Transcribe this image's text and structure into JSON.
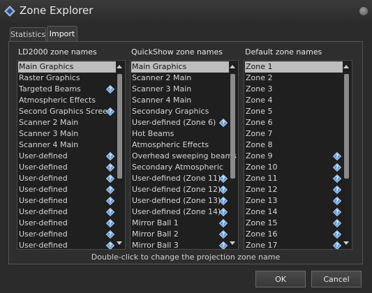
{
  "window": {
    "title": "Zone Explorer"
  },
  "tabs": [
    {
      "label": "Statistics"
    },
    {
      "label": "Import"
    }
  ],
  "columns": [
    {
      "title": "LD2000 zone names",
      "items": [
        {
          "label": "Main Graphics",
          "selected": true,
          "help": false
        },
        {
          "label": "Raster Graphics",
          "selected": false,
          "help": false
        },
        {
          "label": "Targeted Beams",
          "selected": false,
          "help": true
        },
        {
          "label": "Atmospheric Effects",
          "selected": false,
          "help": false
        },
        {
          "label": "Second Graphics Screen",
          "selected": false,
          "help": true
        },
        {
          "label": "Scanner 2 Main",
          "selected": false,
          "help": false
        },
        {
          "label": "Scanner 3 Main",
          "selected": false,
          "help": false
        },
        {
          "label": "Scanner 4 Main",
          "selected": false,
          "help": false
        },
        {
          "label": "User-defined",
          "selected": false,
          "help": true
        },
        {
          "label": "User-defined",
          "selected": false,
          "help": true
        },
        {
          "label": "User-defined",
          "selected": false,
          "help": true
        },
        {
          "label": "User-defined",
          "selected": false,
          "help": true
        },
        {
          "label": "User-defined",
          "selected": false,
          "help": true
        },
        {
          "label": "User-defined",
          "selected": false,
          "help": true
        },
        {
          "label": "User-defined",
          "selected": false,
          "help": true
        },
        {
          "label": "User-defined",
          "selected": false,
          "help": true
        },
        {
          "label": "User-defined",
          "selected": false,
          "help": true
        }
      ]
    },
    {
      "title": "QuickShow zone names",
      "items": [
        {
          "label": "Main Graphics",
          "selected": true,
          "help": false
        },
        {
          "label": "Scanner 2 Main",
          "selected": false,
          "help": false
        },
        {
          "label": "Scanner 3 Main",
          "selected": false,
          "help": false
        },
        {
          "label": "Scanner 4 Main",
          "selected": false,
          "help": false
        },
        {
          "label": "Secondary Graphics",
          "selected": false,
          "help": false
        },
        {
          "label": "User-defined (Zone 6)",
          "selected": false,
          "help": true
        },
        {
          "label": "Hot Beams",
          "selected": false,
          "help": false
        },
        {
          "label": "Atmospheric Effects",
          "selected": false,
          "help": false
        },
        {
          "label": "Overhead sweeping beams",
          "selected": false,
          "help": false
        },
        {
          "label": "Secondary Atmospheric",
          "selected": false,
          "help": false
        },
        {
          "label": "User-defined (Zone 11)",
          "selected": false,
          "help": true
        },
        {
          "label": "User-defined (Zone 12)",
          "selected": false,
          "help": true
        },
        {
          "label": "User-defined (Zone 13)",
          "selected": false,
          "help": true
        },
        {
          "label": "User-defined (Zone 14)",
          "selected": false,
          "help": true
        },
        {
          "label": "Mirror Ball 1",
          "selected": false,
          "help": true
        },
        {
          "label": "Mirror Ball 2",
          "selected": false,
          "help": true
        },
        {
          "label": "Mirror Ball 3",
          "selected": false,
          "help": true
        }
      ]
    },
    {
      "title": "Default zone names",
      "items": [
        {
          "label": "Zone 1",
          "selected": true,
          "help": false
        },
        {
          "label": "Zone 2",
          "selected": false,
          "help": false
        },
        {
          "label": "Zone 3",
          "selected": false,
          "help": false
        },
        {
          "label": "Zone 4",
          "selected": false,
          "help": false
        },
        {
          "label": "Zone 5",
          "selected": false,
          "help": false
        },
        {
          "label": "Zone 6",
          "selected": false,
          "help": false
        },
        {
          "label": "Zone 7",
          "selected": false,
          "help": false
        },
        {
          "label": "Zone 8",
          "selected": false,
          "help": false
        },
        {
          "label": "Zone 9",
          "selected": false,
          "help": true
        },
        {
          "label": "Zone 10",
          "selected": false,
          "help": true
        },
        {
          "label": "Zone 11",
          "selected": false,
          "help": true
        },
        {
          "label": "Zone 12",
          "selected": false,
          "help": true
        },
        {
          "label": "Zone 13",
          "selected": false,
          "help": true
        },
        {
          "label": "Zone 14",
          "selected": false,
          "help": true
        },
        {
          "label": "Zone 15",
          "selected": false,
          "help": true
        },
        {
          "label": "Zone 16",
          "selected": false,
          "help": true
        },
        {
          "label": "Zone 17",
          "selected": false,
          "help": true
        }
      ]
    }
  ],
  "hint": "Double-click to change the projection zone name",
  "buttons": {
    "ok": "OK",
    "cancel": "Cancel"
  }
}
